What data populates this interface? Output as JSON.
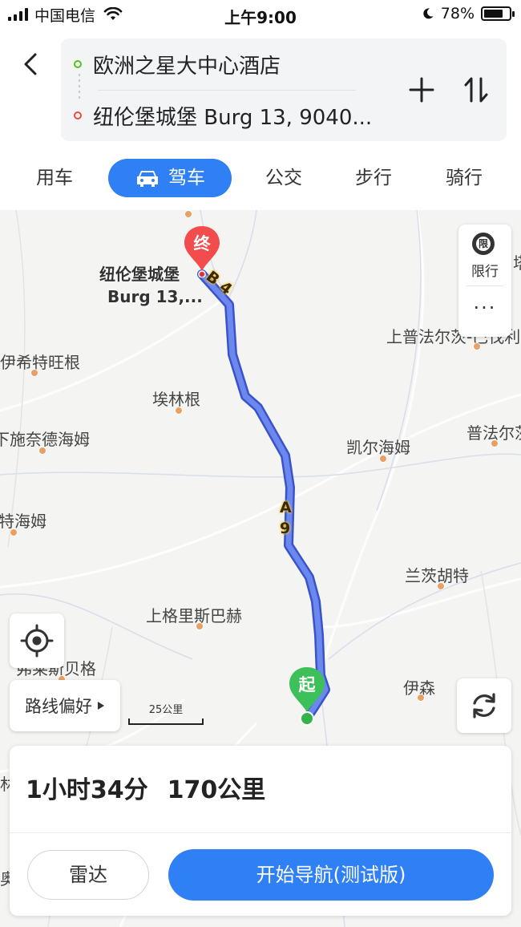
{
  "status_bar": {
    "carrier": "中国电信",
    "time": "上午9:00",
    "battery": "78%",
    "battery_level": 0.78
  },
  "header": {
    "origin": "欧洲之星大中心酒店",
    "destination": "纽伦堡城堡 Burg 13, 9040...",
    "origin_color": "#52c41a",
    "destination_color": "#f5453d"
  },
  "tabs": [
    {
      "label": "用车",
      "active": false
    },
    {
      "label": "驾车",
      "active": true
    },
    {
      "label": "公交",
      "active": false
    },
    {
      "label": "步行",
      "active": false
    },
    {
      "label": "骑行",
      "active": false
    }
  ],
  "map": {
    "places": {
      "yixi": "伊希特旺根",
      "ailin": "埃林根",
      "shinaide": "下施奈德海姆",
      "tehaimu": "特海姆",
      "kaier": "凯尔海姆",
      "shangpufa": "上普法尔茨-巴伐利亚",
      "pufa": "普法尔茨",
      "tower": "塔",
      "lanci": "兰茨胡特",
      "shanggeli": "上格里斯巴赫",
      "huosi": "弗莱斯贝格",
      "yisen": "伊森",
      "edge1": "林",
      "edge2": "奥"
    },
    "destination_label_line1": "纽伦堡城堡",
    "destination_label_line2": "Burg 13,...",
    "end_marker": "终",
    "start_marker": "起",
    "road_b4": "B 4",
    "road_a9_1": "A",
    "road_a9_2": "9",
    "route_color": "#4a6ee8"
  },
  "controls": {
    "limit_label": "限行",
    "limit_icon_text": "限",
    "more": "···",
    "route_pref": "路线偏好",
    "scale_label": "25公里"
  },
  "card": {
    "duration": "1小时34分",
    "distance": "170公里",
    "radar": "雷达",
    "start_nav": "开始导航(测试版)"
  }
}
